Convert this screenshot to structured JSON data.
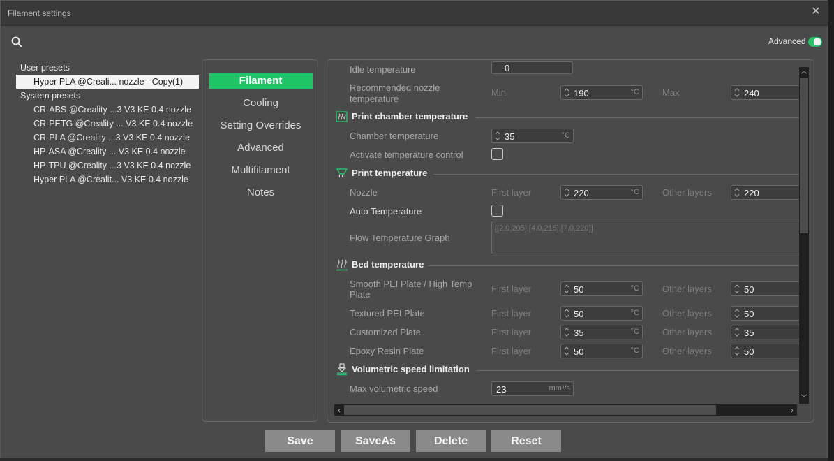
{
  "window": {
    "title": "Filament settings",
    "close": "✕"
  },
  "advanced": {
    "label": "Advanced",
    "enabled": true
  },
  "presets": {
    "user_group": "User presets",
    "user_items": [
      "Hyper PLA @Creali... nozzle - Copy(1)"
    ],
    "system_group": "System presets",
    "system_items": [
      "CR-ABS @Creality ...3 V3 KE 0.4 nozzle",
      "CR-PETG @Creality ... V3 KE 0.4 nozzle",
      "CR-PLA @Creality ...3 V3 KE 0.4 nozzle",
      "HP-ASA @Creality ... V3 KE 0.4 nozzle",
      "HP-TPU @Creality ...3 V3 KE 0.4 nozzle",
      "Hyper PLA @Crealit... V3 KE 0.4 nozzle"
    ]
  },
  "tabs": [
    "Filament",
    "Cooling",
    "Setting Overrides",
    "Advanced",
    "Multifilament",
    "Notes"
  ],
  "settings": {
    "idle_temp": {
      "label": "Idle temperature",
      "value": "0"
    },
    "rec_nozzle": {
      "label_line1": "Recommended nozzle",
      "label_line2": "temperature",
      "min_label": "Min",
      "min": "190",
      "max_label": "Max",
      "max": "240",
      "unit": "°C"
    },
    "chamber_section": "Print chamber temperature",
    "chamber_temp": {
      "label": "Chamber temperature",
      "value": "35",
      "unit": "°C"
    },
    "activate_temp": {
      "label": "Activate temperature control"
    },
    "print_section": "Print temperature",
    "nozzle": {
      "label": "Nozzle",
      "first_label": "First layer",
      "first": "220",
      "other_label": "Other layers",
      "other": "220",
      "unit": "°C"
    },
    "auto_temp": {
      "label": "Auto Temperature"
    },
    "flow_graph": {
      "label": "Flow Temperature Graph",
      "value": "[[2.0,205],[4.0,215],[7.0,220]]"
    },
    "bed_section": "Bed temperature",
    "beds": [
      {
        "label_line1": "Smooth PEI Plate / High Temp",
        "label_line2": "Plate",
        "first": "50",
        "other": "50"
      },
      {
        "label_line1": "Textured PEI Plate",
        "label_line2": "",
        "first": "50",
        "other": "50"
      },
      {
        "label_line1": "Customized Plate",
        "label_line2": "",
        "first": "35",
        "other": "35"
      },
      {
        "label_line1": "Epoxy Resin Plate",
        "label_line2": "",
        "first": "50",
        "other": "50"
      }
    ],
    "first_layer": "First layer",
    "other_layers": "Other layers",
    "unit_c": "°C",
    "vol_section": "Volumetric speed limitation",
    "max_vol": {
      "label": "Max volumetric speed",
      "value": "23",
      "unit": "mm³/s"
    }
  },
  "buttons": {
    "save": "Save",
    "save_as": "SaveAs",
    "delete": "Delete",
    "reset": "Reset"
  },
  "colors": {
    "accent": "#1ec466",
    "panel_bg": "#4a4a4a",
    "title_bg": "#393939"
  }
}
